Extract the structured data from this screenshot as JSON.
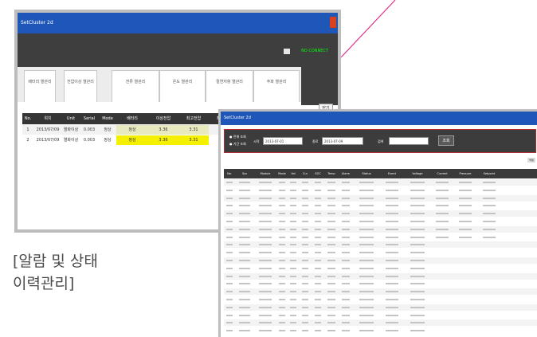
{
  "colors": {
    "pointer_line": "#e0308a",
    "titlebar": "#1f57b8",
    "dark_band": "#3e3e3e",
    "highlight_yellow": "#f5f000",
    "filter_border": "#b03030"
  },
  "alarm_window": {
    "title": "SetCluster 2d",
    "status_text": "NO CONNECT",
    "tabs": [
      {
        "label": "배터리 열관리"
      },
      {
        "label": "전압이상 열관리"
      },
      {
        "label": "전류 열관리"
      },
      {
        "label": "온도 열관리"
      },
      {
        "label": "절연저항 열관리"
      },
      {
        "label": "주파 열관리"
      }
    ],
    "small_button": "닫기",
    "table": {
      "headers": [
        "No.",
        "위치",
        "Unit",
        "Serial",
        "Mode",
        "배터리",
        "이상전압",
        "최고전압",
        "최저전압"
      ],
      "rows": [
        [
          "1",
          "2013/07/09",
          "열화이상",
          "0.003",
          "정상",
          "정상",
          "3.36",
          "3.31",
          ""
        ],
        [
          "2",
          "2013/07/09",
          "열화이상",
          "0.003",
          "정상",
          "정상",
          "3.36",
          "3.31",
          ""
        ]
      ]
    }
  },
  "status_window": {
    "title": "SetCluster 2d",
    "filter": {
      "radio_options": [
        "전체 조회",
        "기간 조회"
      ],
      "label_from": "시작",
      "from_value": "2013-07-01",
      "label_to": "종료",
      "to_value": "2013-07-09",
      "label_keyword": "검색",
      "keyword_value": "",
      "search_button": "조회"
    },
    "small_button": "엑셀",
    "table": {
      "headers": [
        "No.",
        "Sys",
        "Module",
        "Mode",
        "Vol",
        "Cur",
        "SOC",
        "Temp",
        "Alarm",
        "Status",
        "Event",
        "Voltage",
        "Current",
        "Pressure",
        "Setpoint"
      ],
      "row_count": 20
    }
  },
  "caption": {
    "line1": "[알람 및 상태",
    "line2": "이력관리]"
  }
}
